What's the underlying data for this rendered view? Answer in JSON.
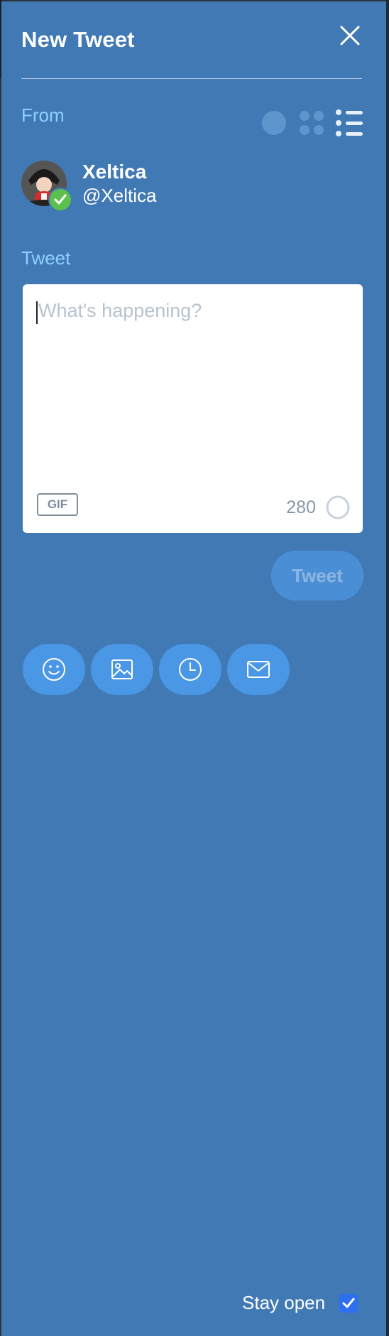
{
  "panel": {
    "title": "New Tweet",
    "close_icon": "close-icon"
  },
  "from": {
    "label": "From",
    "view_modes": [
      "single-account-icon",
      "grid-accounts-icon",
      "list-accounts-icon"
    ]
  },
  "account": {
    "name": "Xeltica",
    "handle": "@Xeltica",
    "verified": true
  },
  "tweet": {
    "label": "Tweet",
    "placeholder": "What's happening?",
    "value": "",
    "gif_label": "GIF",
    "char_count": "280"
  },
  "actions": {
    "submit_label": "Tweet",
    "tools": [
      "emoji-icon",
      "image-icon",
      "schedule-clock-icon",
      "direct-message-icon"
    ]
  },
  "footer": {
    "stay_open_label": "Stay open",
    "stay_open_checked": true
  },
  "colors": {
    "panel_bg": "#4179b5",
    "label_accent": "#8ed0ff",
    "tool_button": "#4a97e5",
    "verified_badge": "#5cc04c",
    "checkbox": "#2d6ff0"
  }
}
